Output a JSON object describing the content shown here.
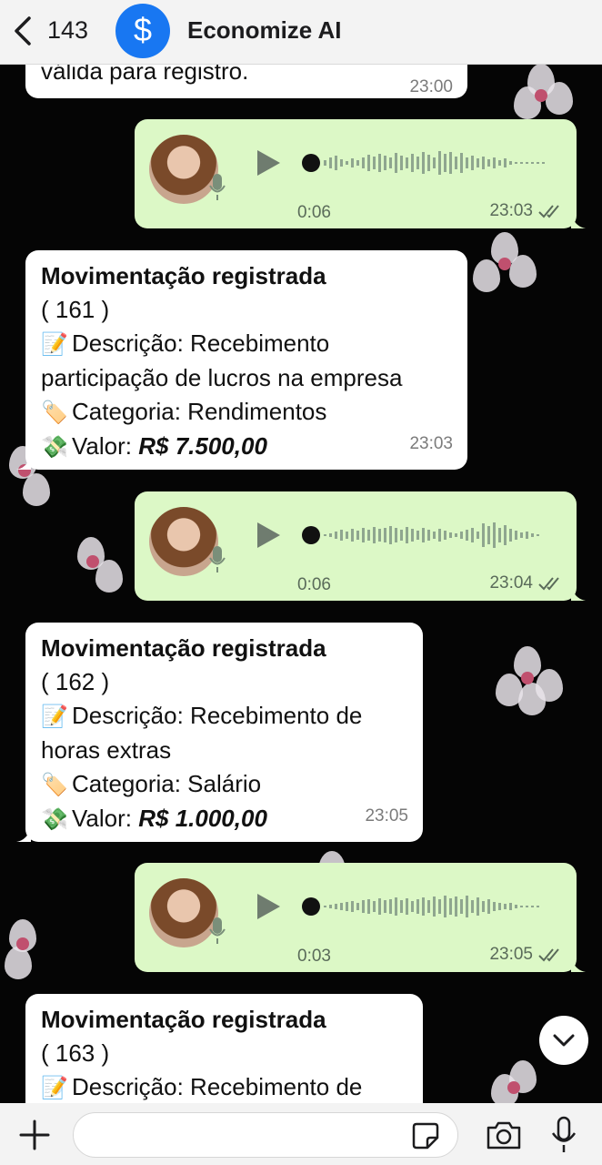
{
  "header": {
    "back_count": "143",
    "contact_name": "Economize AI",
    "avatar_symbol": "$",
    "avatar_color": "#1877f2"
  },
  "messages": [
    {
      "type": "in",
      "partial_text": "válida para registro.",
      "time": "23:00"
    },
    {
      "type": "voice",
      "duration": "0:06",
      "time": "23:03"
    },
    {
      "type": "in",
      "title": "Movimentação registrada",
      "id": "( 161 )",
      "descricao": "Descrição: Recebimento participação de lucros na empresa",
      "categoria": "Categoria: Rendimentos",
      "valor_label": "Valor:",
      "valor": "R$ 7.500,00",
      "time": "23:03"
    },
    {
      "type": "voice",
      "duration": "0:06",
      "time": "23:04"
    },
    {
      "type": "in",
      "title": "Movimentação registrada",
      "id": "( 162 )",
      "descricao": "Descrição: Recebimento de horas extras",
      "categoria": "Categoria: Salário",
      "valor_label": "Valor:",
      "valor": "R$ 1.000,00",
      "time": "23:05"
    },
    {
      "type": "voice",
      "duration": "0:03",
      "time": "23:05"
    },
    {
      "type": "in",
      "title": "Movimentação registrada",
      "id": "( 163 )",
      "descricao": "Descrição: Recebimento de"
    }
  ],
  "emojis": {
    "memo": "📝",
    "tag": "🏷️",
    "money": "💸"
  },
  "composer": {
    "placeholder": ""
  },
  "colors": {
    "bubble_out": "#dcf8c6",
    "bubble_in": "#ffffff",
    "header_bg": "#f3f3f3",
    "background": "#050505"
  }
}
